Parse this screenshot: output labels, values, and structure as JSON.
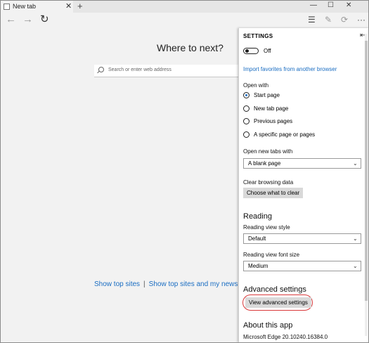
{
  "tab": {
    "label": "New tab"
  },
  "page": {
    "heading": "Where to next?",
    "search_placeholder": "Search or enter web address",
    "top_sites_link1": "Show top sites",
    "top_sites_link2": "Show top sites and my news feed",
    "separator": "|"
  },
  "settings": {
    "title": "SETTINGS",
    "toggle_label": "Off",
    "import_link": "Import favorites from another browser",
    "open_with_label": "Open with",
    "open_with_options": [
      "Start page",
      "New tab page",
      "Previous pages",
      "A specific page or pages"
    ],
    "open_with_selected_index": 0,
    "new_tabs_label": "Open new tabs with",
    "new_tabs_value": "A blank page",
    "clear_label": "Clear browsing data",
    "clear_button": "Choose what to clear",
    "reading_heading": "Reading",
    "reading_style_label": "Reading view style",
    "reading_style_value": "Default",
    "reading_font_label": "Reading view font size",
    "reading_font_value": "Medium",
    "advanced_heading": "Advanced settings",
    "advanced_button": "View advanced settings",
    "about_heading": "About this app",
    "about_version": "Microsoft Edge 20.10240.16384.0"
  },
  "colors": {
    "accent": "#1a6dc2",
    "highlight_ring": "#d9383a"
  }
}
